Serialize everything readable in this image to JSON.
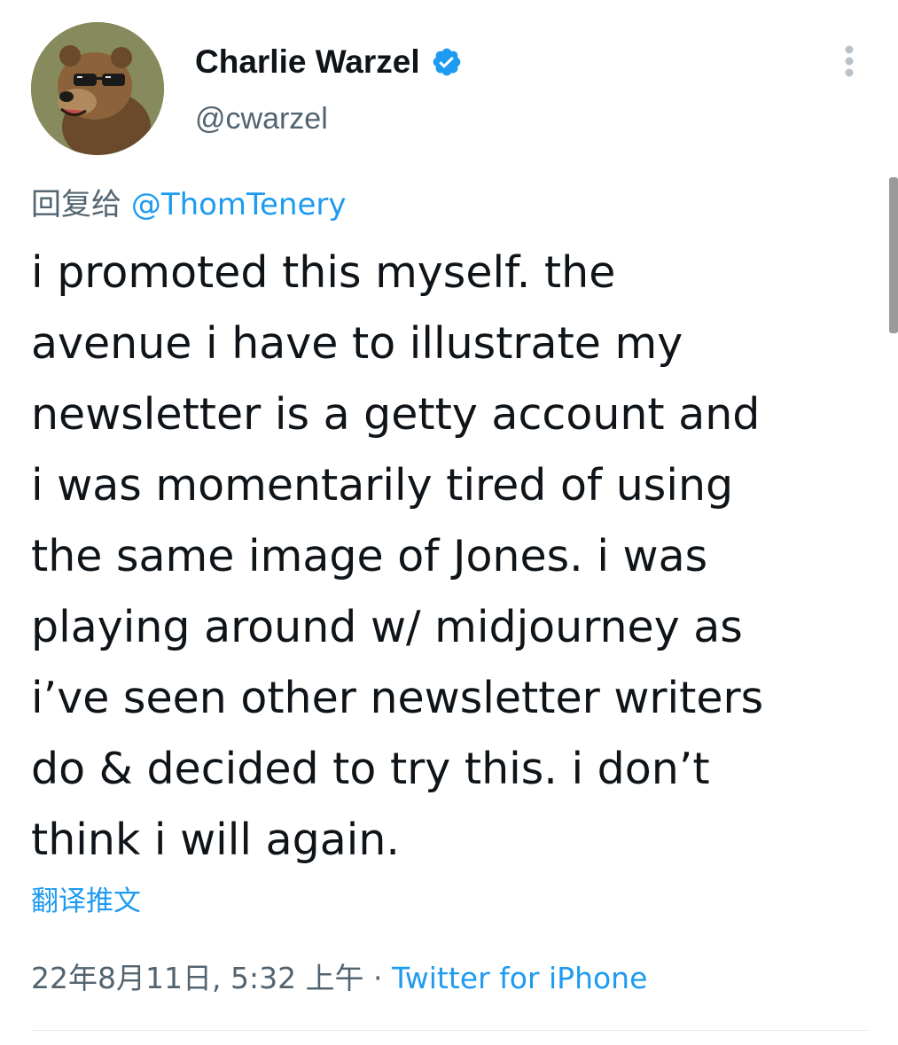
{
  "tweet": {
    "author": {
      "display_name": "Charlie Warzel",
      "handle": "@cwarzel",
      "verified": true,
      "avatar_icon": "bear-with-sunglasses-avatar"
    },
    "reply_prefix": "回复给",
    "reply_to": "@ThomTenery",
    "text_lines": [
      "i promoted this myself. the",
      "avenue i have to illustrate my",
      "newsletter is a getty account and",
      "i was momentarily tired of using",
      "the same image of Jones. i was",
      "playing around w/ midjourney as",
      "i’ve seen other newsletter writers",
      "do & decided to try this. i don’t",
      "think i will again."
    ],
    "translate_label": "翻译推文",
    "timestamp": "22年8月11日, 5:32 上午",
    "separator": " · ",
    "source": "Twitter for iPhone"
  },
  "colors": {
    "accent": "#1d9bf0",
    "text": "#0f1419",
    "secondary": "#536471"
  },
  "icons": {
    "verified": "verified-badge-icon",
    "more": "more-options-icon"
  }
}
